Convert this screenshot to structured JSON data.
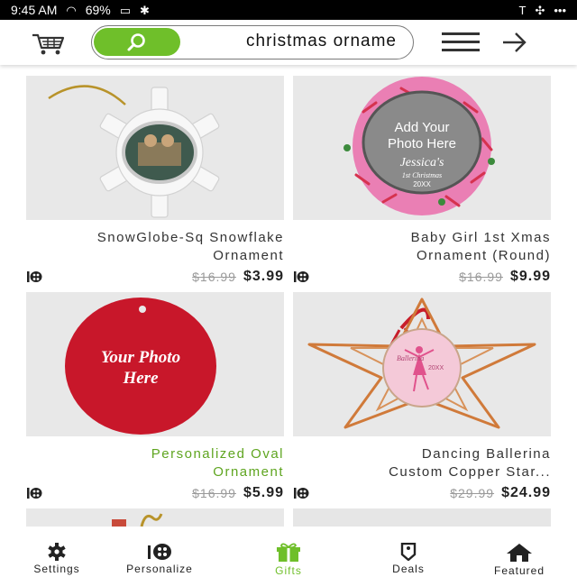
{
  "status_bar": {
    "time": "9:45 AM",
    "battery": "69%",
    "signal": "•••"
  },
  "header": {
    "search_value": "christmas orname",
    "cart_icon": "cart-icon",
    "menu_icon": "hamburger-icon",
    "back_icon": "arrow-icon"
  },
  "products": [
    {
      "title_line1": "SnowGlobe-Sq Snowflake",
      "title_line2": "Ornament",
      "price": "$3.99",
      "old_price": "$16.99"
    },
    {
      "title_line1": "Baby Girl 1st Xmas",
      "title_line2": "Ornament (Round)",
      "price": "$9.99",
      "old_price": "$16.99",
      "art_text1": "Add Your",
      "art_text2": "Photo Here",
      "art_text3": "Jessica's",
      "art_text4": "1st Christmas",
      "art_text5": "20XX"
    },
    {
      "title_line1": "Personalized Oval",
      "title_line2": "Ornament",
      "price": "$5.99",
      "old_price": "$16.99",
      "art_text1": "Your Photo",
      "art_text2": "Here"
    },
    {
      "title_line1": "Dancing Ballerina",
      "title_line2": "Custom Copper Star...",
      "price": "$24.99",
      "old_price": "$29.99",
      "art_text1": "Ballerina",
      "art_text2": "20XX"
    }
  ],
  "bottom_nav": [
    {
      "label": "Settings",
      "icon": "gear-icon"
    },
    {
      "label": "Personalize",
      "icon": "palette-icon"
    },
    {
      "label": "Gifts",
      "icon": "gift-icon",
      "active": true
    },
    {
      "label": "Deals",
      "icon": "tag-icon"
    },
    {
      "label": "Featured",
      "icon": "home-icon"
    }
  ],
  "colors": {
    "accent": "#6fbf2a",
    "title_link": "#5fa520",
    "thumb_bg": "#e6e6e6"
  }
}
